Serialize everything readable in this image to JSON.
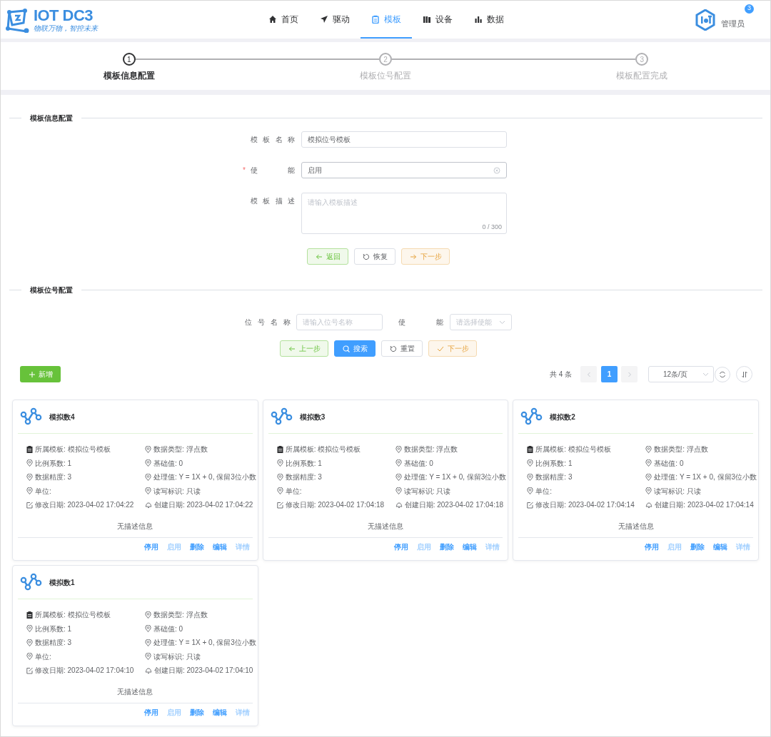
{
  "header": {
    "logo": {
      "title": "IOT DC3",
      "slogan": "物联万物，智控未来"
    },
    "nav": [
      {
        "label": "首页",
        "selected": false
      },
      {
        "label": "驱动",
        "selected": false
      },
      {
        "label": "模板",
        "selected": true
      },
      {
        "label": "设备",
        "selected": false
      },
      {
        "label": "数据",
        "selected": false
      }
    ],
    "user": {
      "name": "管理员",
      "badge": "3"
    }
  },
  "steps": [
    {
      "number": "1",
      "label": "模板信息配置",
      "selected": true
    },
    {
      "number": "2",
      "label": "模板位号配置",
      "selected": false
    },
    {
      "number": "3",
      "label": "模板配置完成",
      "selected": false
    }
  ],
  "template_section": {
    "title": "模板信息配置",
    "required_mark": "*",
    "fields": [
      {
        "kind": "input",
        "label": "模板名称",
        "required": false,
        "value": "模拟位号模板"
      },
      {
        "kind": "select",
        "label": "使能",
        "required": true,
        "value": "启用"
      },
      {
        "kind": "textarea",
        "label": "模板描述",
        "required": false,
        "placeholder": "请输入模板描述",
        "count": "0 / 300"
      }
    ],
    "buttons": [
      {
        "kind": "success",
        "label": "返回"
      },
      {
        "kind": "default",
        "label": "恢复"
      },
      {
        "kind": "warning",
        "label": "下一步"
      }
    ]
  },
  "point_section": {
    "title": "模板位号配置",
    "filters": [
      {
        "kind": "input",
        "label": "位号名称",
        "placeholder": "请输入位号名称"
      },
      {
        "kind": "select",
        "label": "使能",
        "placeholder": "请选择使能"
      }
    ],
    "buttons": [
      {
        "kind": "success",
        "label": "上一步"
      },
      {
        "kind": "primary",
        "label": "搜索"
      },
      {
        "kind": "default",
        "label": "重置"
      },
      {
        "kind": "warning",
        "label": "下一步"
      }
    ],
    "add_button": "新增",
    "pagination": {
      "total": "共 4 条",
      "pages": [
        {
          "label": "1",
          "selected": true
        }
      ],
      "page_size": "12条/页"
    },
    "cards": [
      {
        "title": "模拟数4",
        "fields": [
          "所属模板: 模拟位号模板",
          "数据类型: 浮点数",
          "比例系数: 1",
          "基础值: 0",
          "数据精度: 3",
          "处理值: Y = 1X + 0, 保留3位小数",
          "单位:",
          "读写标识: 只读",
          "修改日期: 2023-04-02 17:04:22",
          "创建日期: 2023-04-02 17:04:22"
        ],
        "description": "无描述信息",
        "actions": [
          {
            "label": "停用",
            "disabled": false
          },
          {
            "label": "启用",
            "disabled": true
          },
          {
            "label": "删除",
            "disabled": false
          },
          {
            "label": "编辑",
            "disabled": false
          },
          {
            "label": "详情",
            "disabled": true
          }
        ]
      },
      {
        "title": "模拟数3",
        "fields": [
          "所属模板: 模拟位号模板",
          "数据类型: 浮点数",
          "比例系数: 1",
          "基础值: 0",
          "数据精度: 3",
          "处理值: Y = 1X + 0, 保留3位小数",
          "单位:",
          "读写标识: 只读",
          "修改日期: 2023-04-02 17:04:18",
          "创建日期: 2023-04-02 17:04:18"
        ],
        "description": "无描述信息",
        "actions": [
          {
            "label": "停用",
            "disabled": false
          },
          {
            "label": "启用",
            "disabled": true
          },
          {
            "label": "删除",
            "disabled": false
          },
          {
            "label": "编辑",
            "disabled": false
          },
          {
            "label": "详情",
            "disabled": true
          }
        ]
      },
      {
        "title": "模拟数2",
        "fields": [
          "所属模板: 模拟位号模板",
          "数据类型: 浮点数",
          "比例系数: 1",
          "基础值: 0",
          "数据精度: 3",
          "处理值: Y = 1X + 0, 保留3位小数",
          "单位:",
          "读写标识: 只读",
          "修改日期: 2023-04-02 17:04:14",
          "创建日期: 2023-04-02 17:04:14"
        ],
        "description": "无描述信息",
        "actions": [
          {
            "label": "停用",
            "disabled": false
          },
          {
            "label": "启用",
            "disabled": true
          },
          {
            "label": "删除",
            "disabled": false
          },
          {
            "label": "编辑",
            "disabled": false
          },
          {
            "label": "详情",
            "disabled": true
          }
        ]
      },
      {
        "title": "模拟数1",
        "fields": [
          "所属模板: 模拟位号模板",
          "数据类型: 浮点数",
          "比例系数: 1",
          "基础值: 0",
          "数据精度: 3",
          "处理值: Y = 1X + 0, 保留3位小数",
          "单位:",
          "读写标识: 只读",
          "修改日期: 2023-04-02 17:04:10",
          "创建日期: 2023-04-02 17:04:10"
        ],
        "description": "无描述信息",
        "actions": [
          {
            "label": "停用",
            "disabled": false
          },
          {
            "label": "启用",
            "disabled": true
          },
          {
            "label": "删除",
            "disabled": false
          },
          {
            "label": "编辑",
            "disabled": false
          },
          {
            "label": "详情",
            "disabled": true
          }
        ]
      }
    ]
  }
}
